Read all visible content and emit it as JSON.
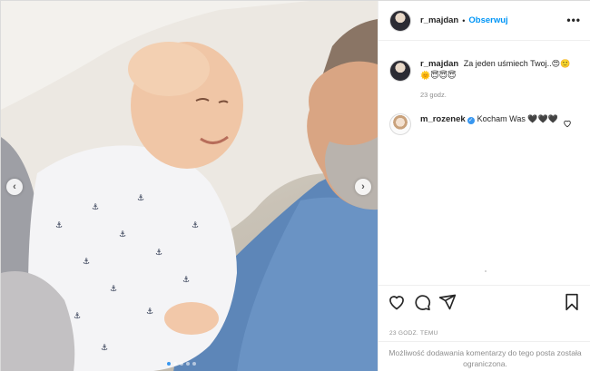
{
  "post": {
    "author": "r_majdan",
    "follow_label": "Obserwuj",
    "separator": "•",
    "more_label": "•••",
    "caption": "Za jeden uśmiech Twoj..😍🙂🌞😇😇😇",
    "caption_time": "23 godz.",
    "time_ago": "23 GODZ. TEMU",
    "comments_disabled": "Możliwość dodawania komentarzy do tego posta została ograniczona."
  },
  "comments": [
    {
      "username": "m_rozenek",
      "verified": true,
      "text": "Kocham Was 🖤🖤🖤"
    }
  ],
  "carousel": {
    "prev_label": "‹",
    "next_label": "›",
    "slides": 5,
    "active": 0
  },
  "icons": {
    "like": "heart-icon",
    "comment": "comment-icon",
    "share": "share-icon",
    "save": "bookmark-icon"
  },
  "colors": {
    "link": "#0095f6",
    "verified": "#3897f0",
    "muted": "#8e8e8e"
  }
}
